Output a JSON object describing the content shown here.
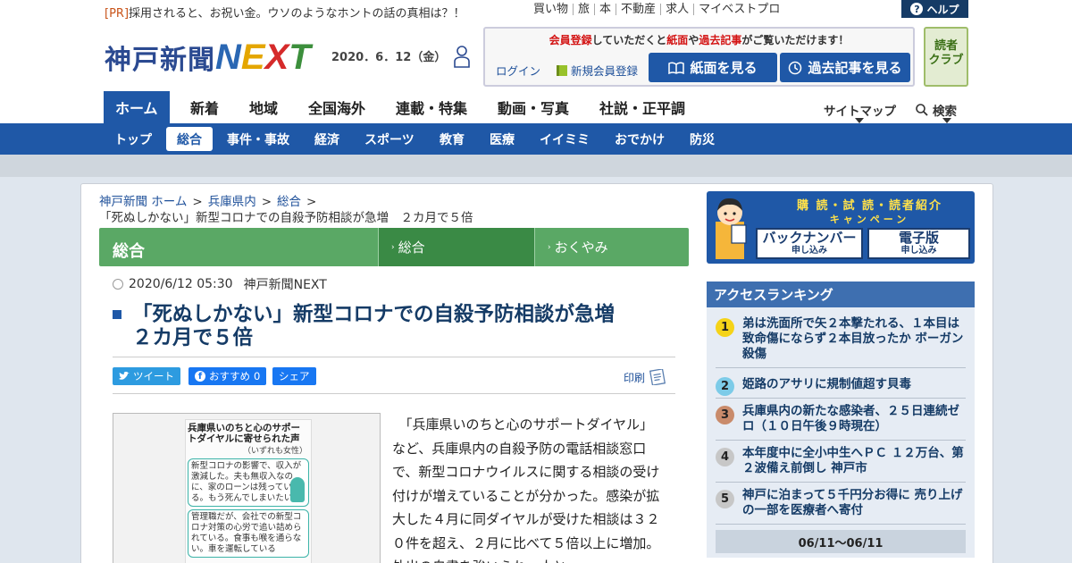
{
  "top": {
    "pr_tag": "[PR]",
    "pr_text": "採用されると、お祝い金。ウソのようなホントの話の真相は？！",
    "links": [
      "買い物",
      "旅",
      "本",
      "不動産",
      "求人",
      "マイベストプロ"
    ],
    "help": "ヘルプ"
  },
  "header": {
    "logo_kanji": "神戸新聞",
    "logo_n": "N",
    "logo_e": "E",
    "logo_x": "X",
    "logo_t": "T",
    "date": "2020．6．12（金）",
    "member_red1": "会員登録",
    "member_mid1": "していただくと",
    "member_red2": "紙面",
    "member_mid2": "や",
    "member_red3": "過去記事",
    "member_end": "がご覧いただけます！",
    "login": "ログイン",
    "new_member": "新規会員登録",
    "btn_paper": "紙面を見る",
    "btn_past": "過去記事を見る",
    "reader_club_1": "読者",
    "reader_club_2": "クラブ"
  },
  "mainnav": {
    "items": [
      "ホーム",
      "新着",
      "地域",
      "全国海外",
      "連載・特集",
      "動画・写真",
      "社説・正平調"
    ],
    "sitemap": "サイトマップ",
    "search": "検索"
  },
  "subnav": {
    "items": [
      "トップ",
      "総合",
      "事件・事故",
      "経済",
      "スポーツ",
      "教育",
      "医療",
      "イイミミ",
      "おでかけ",
      "防災"
    ]
  },
  "breadcrumb": {
    "home": "神戸新聞 ホーム",
    "pref": "兵庫県内",
    "cat": "総合",
    "current": "「死ぬしかない」新型コロナでの自殺予防相談が急増　２カ月で５倍"
  },
  "category_bar": {
    "title": "総合",
    "tab1": "総合",
    "tab2": "おくやみ"
  },
  "article": {
    "datetime": "2020/6/12 05:30",
    "source": "神戸新聞NEXT",
    "title_line1": "「死ぬしかない」新型コロナでの自殺予防相談が急増",
    "title_line2": "２カ月で５倍",
    "tweet": "ツイート",
    "fb_recommend": "おすすめ",
    "fb_count": "0",
    "fb_share": "シェア",
    "print": "印刷",
    "body": "　「兵庫県いのちと心のサポートダイヤル」など、兵庫県内の自殺予防の電話相談窓口で、新型コロナウイルスに関する相談の受け付けが増えていることが分かった。感染が拡大した４月に同ダイヤルが受けた相談は３２０件を超え、２月に比べて５倍以上に増加。外出の自粛を強いられ、人と",
    "image": {
      "title": "兵庫県いのちと心のサポートダイヤルに寄せられた声",
      "subtitle": "（いずれも女性）",
      "quote1": "新型コロナの影響で、収入が激減した。夫も無収入なのに、家のローンは残っている。もう死んでしまいたい",
      "quote2": "管理職だが、会社での新型コロナ対策の心労で追い詰められている。食事も喉を通らない。車を運転している"
    }
  },
  "sidebar": {
    "banner_title": "購 読・試 読・読者紹介",
    "banner_sub": "キャンペーン",
    "banner_left": "バックナンバー",
    "banner_left_sub": "申し込み",
    "banner_right": "電子版",
    "banner_right_sub": "申し込み",
    "ranking_title": "アクセスランキング",
    "ranking": [
      {
        "rank": "1",
        "title": "弟は洗面所で矢２本撃たれる、１本目は致命傷にならず２本目放ったか ボーガン殺傷"
      },
      {
        "rank": "2",
        "title": "姫路のアサリに規制値超す貝毒"
      },
      {
        "rank": "3",
        "title": "兵庫県内の新たな感染者、２５日連続ゼロ（１０日午後９時現在）"
      },
      {
        "rank": "4",
        "title": "本年度中に全小中生へＰＣ １２万台、第２波備え前倒し 神戸市"
      },
      {
        "rank": "5",
        "title": "神戸に泊まって５千円分お得に 売り上げの一部を医療者へ寄付"
      }
    ],
    "ranking_period": "06/11～06/11",
    "colors": {
      "rank1": "#f5d318",
      "rank2": "#7ccbe8",
      "rank3": "#c98b6b",
      "rank4": "#c7c7c7",
      "rank5": "#c7c7c7"
    }
  }
}
